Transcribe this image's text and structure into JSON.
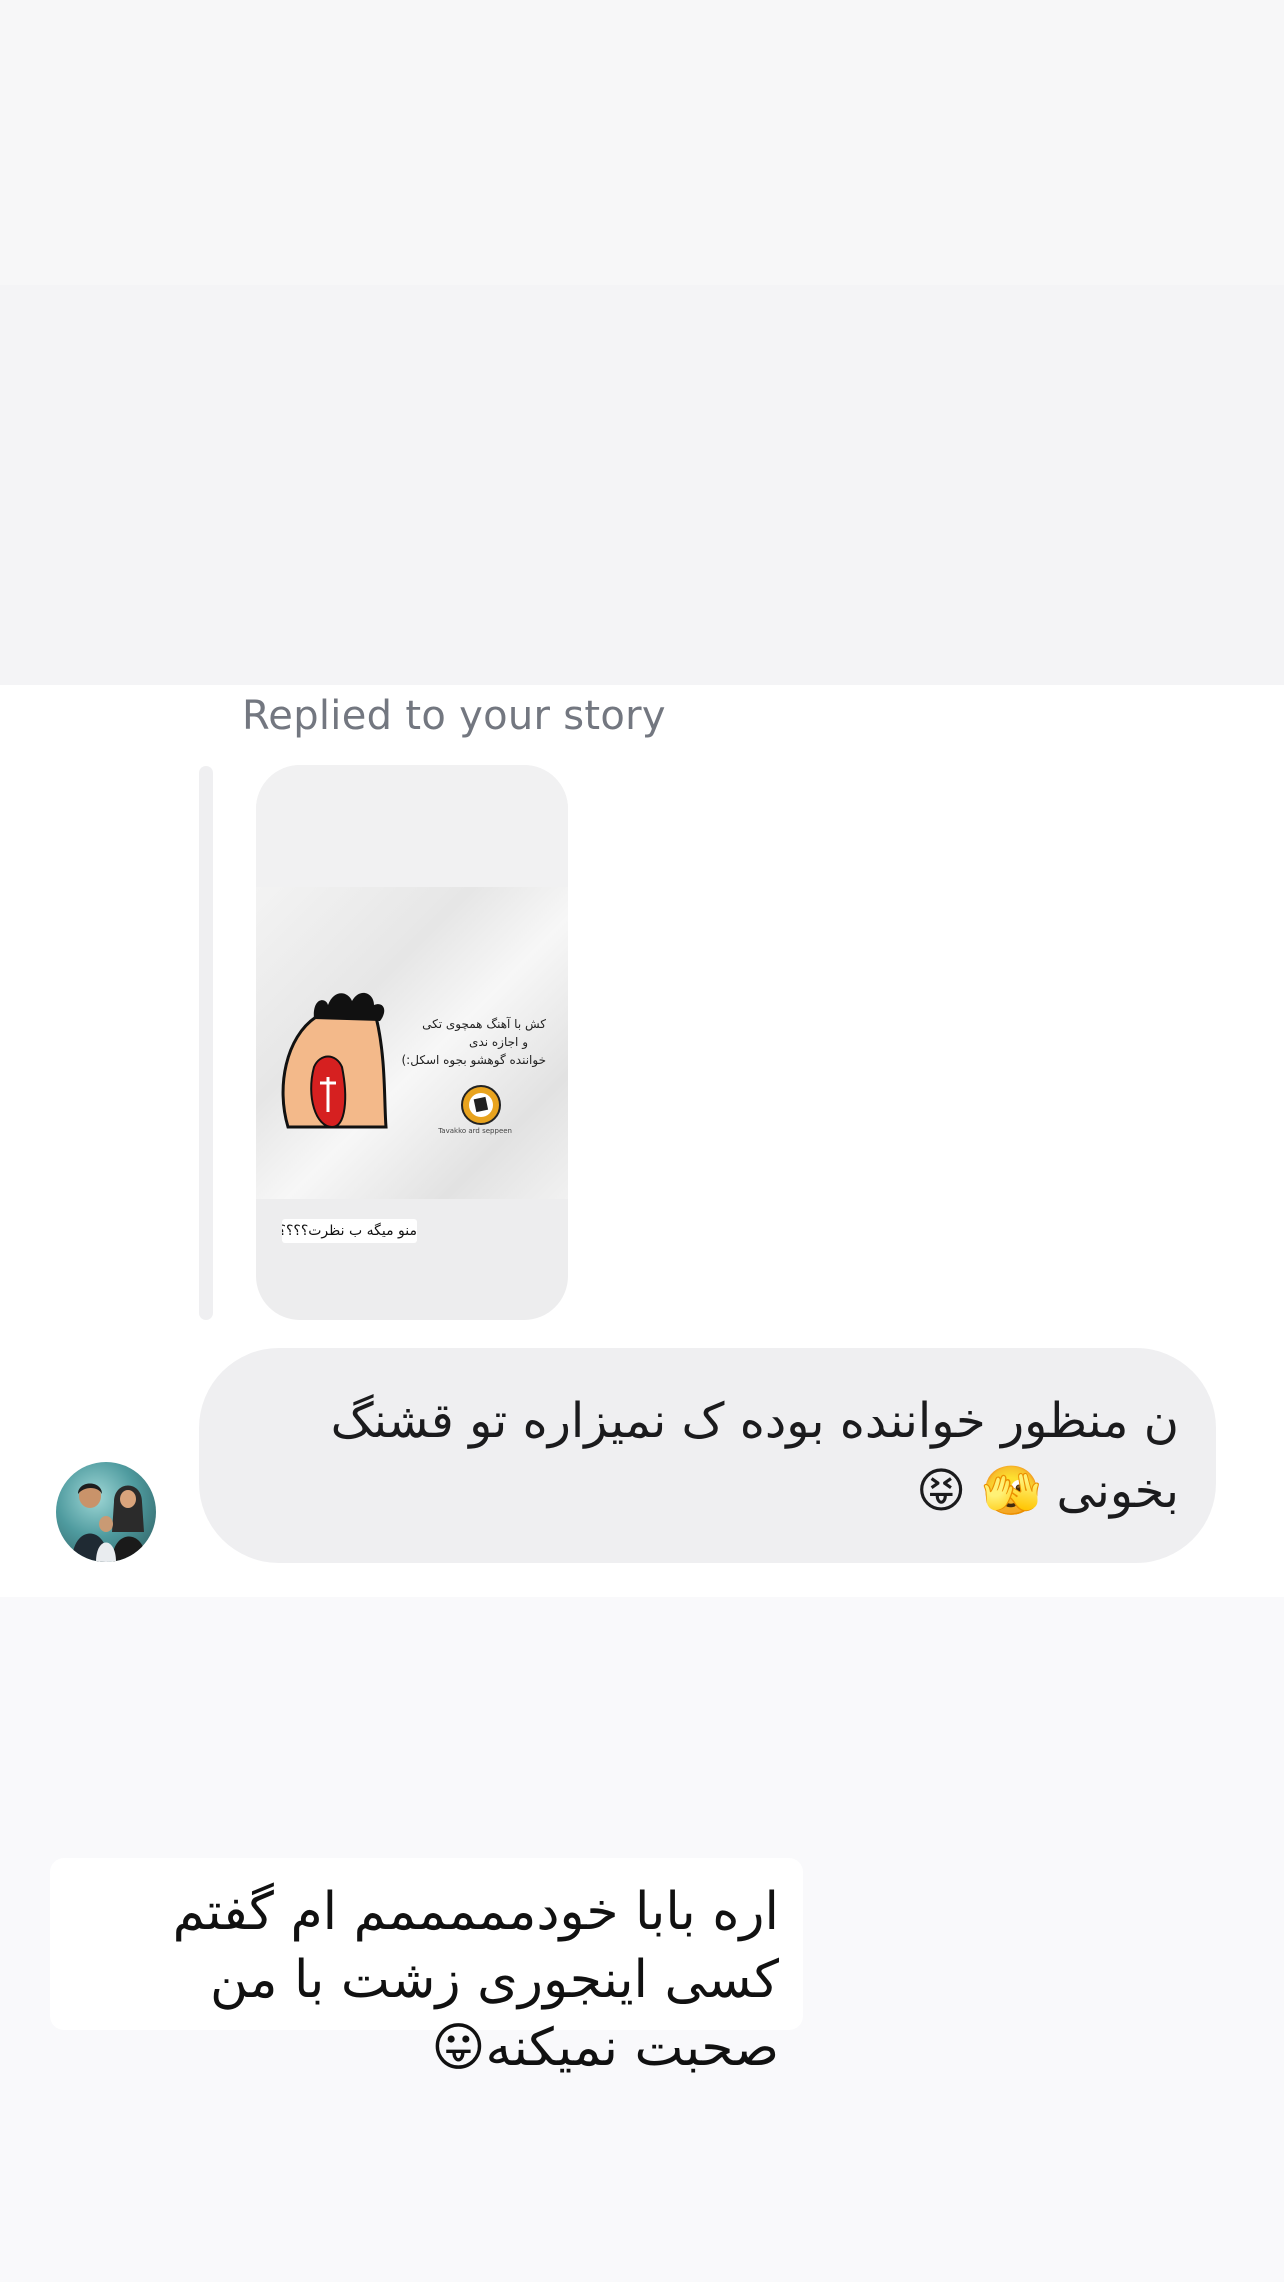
{
  "reply_header": "Replied to your story",
  "story": {
    "caption": "منو میگه ب نظرت؟؟؟؟",
    "image_lines": [
      "کش با آهنگ همچوی تکی",
      "و اجازه ندی",
      "خواننده گوهشو بجوه اسکل:)"
    ],
    "badge_text": "Tavakko ard seppeen"
  },
  "incoming_message": {
    "text": "ن منظور خواننده بوده ک نمیزاره تو قشنگ بخونی 🫣 😝"
  },
  "outgoing_message": {
    "text": "اره بابا خودمممممم ام گفتم کسی اینجوری زشت با من صحبت نمیکنه😛"
  },
  "colors": {
    "incoming_bubble": "#efeff1",
    "outgoing_bubble": "#ffffff",
    "reply_label": "#737780"
  }
}
